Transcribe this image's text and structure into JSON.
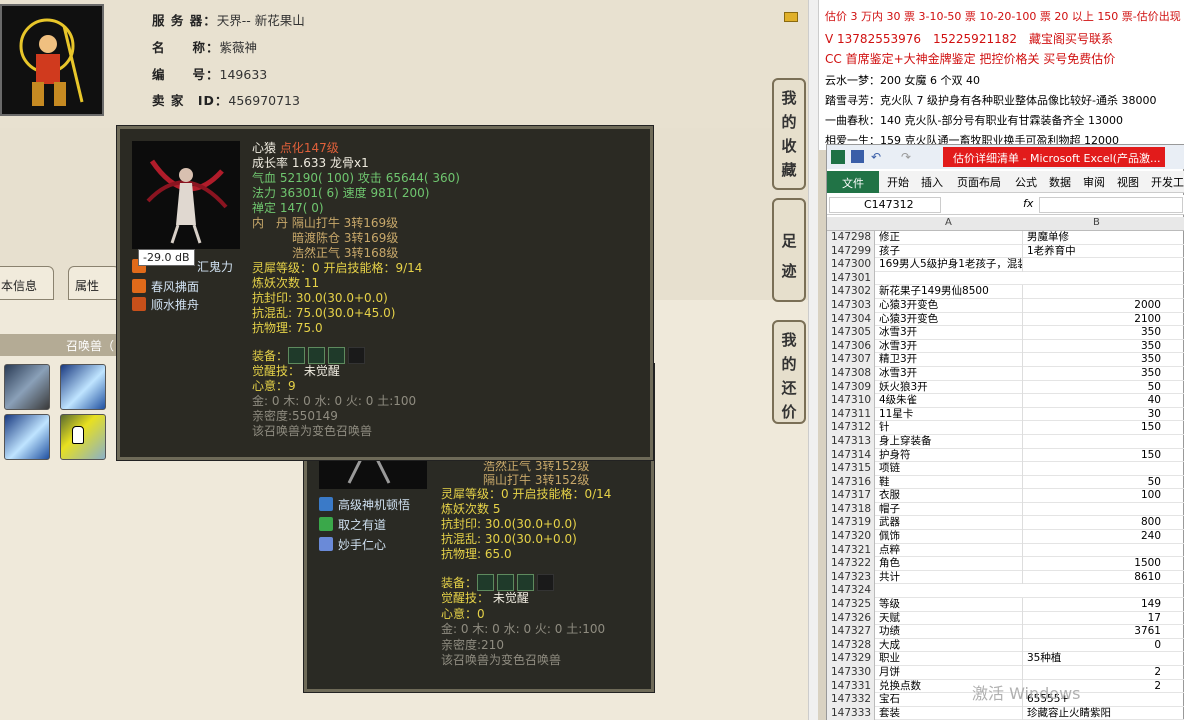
{
  "player": {
    "server_label": "服 务 器：",
    "server_value": "天界-- 新花果山",
    "name_label": "名　　称：",
    "name_value": "紫薇神",
    "id_label": "编　　号：",
    "id_value": "149633",
    "seller_label": "卖 家　ID：",
    "seller_value": "456970713"
  },
  "tabs": {
    "basic": "本信息",
    "attr": "属性"
  },
  "summon_bar": "召唤兽（",
  "side_buttons": [
    {
      "label": "我的收藏"
    },
    {
      "label": "足迹"
    },
    {
      "label": "我的还价"
    }
  ],
  "volume_tooltip": "-29.0 dB",
  "tip_front": {
    "name": "心猿",
    "name_suffix": "点化147级",
    "growth": "成长率 1.633 龙骨x1",
    "hp_label": "气血 ",
    "hp": "52190( 100)",
    "atk_label": " 攻击 ",
    "atk": "65644( 360)",
    "mp_label": "法力 ",
    "mp": "36301( 6)",
    "spd_label": " 速度 ",
    "spd": "981( 200)",
    "zen": "禅定 147( 0)",
    "dan1": "内　丹 隔山打牛 3转169级",
    "dan2": "暗渡陈仓 3转169级",
    "dan3": "浩然正气 3转168级",
    "spirit": "灵犀等级：0 开启技能格：9/14",
    "refine": "炼妖次数 11",
    "res1": "抗封印: 30.0(30.0+0.0)",
    "res2": "抗混乱: 75.0(30.0+45.0)",
    "res3": "抗物理: 75.0",
    "equip_label": "装备：",
    "awaken_label": "觉醒技：",
    "awaken_value": "未觉醒",
    "heart_label": "心意：",
    "heart_value": "9",
    "elements": "金: 0 木: 0 水: 0 火: 0 土:100",
    "intimacy": "亲密度:550149",
    "variant": "该召唤兽为变色召唤兽",
    "skills": [
      "汇鬼力",
      "春风拂面",
      "顺水推舟"
    ]
  },
  "tip_back": {
    "dan_partial1": "浩然正气 3转152级",
    "dan_partial2": "隔山打牛 3转152级",
    "spirit": "灵犀等级：0 开启技能格：0/14",
    "refine": "炼妖次数 5",
    "res1": "抗封印: 30.0(30.0+0.0)",
    "res2": "抗混乱: 30.0(30.0+0.0)",
    "res3": "抗物理: 65.0",
    "equip_label": "装备：",
    "awaken_label": "觉醒技：",
    "awaken_value": "未觉醒",
    "heart_label": "心意：",
    "heart_value": "0",
    "elements": "金: 0 木: 0 水: 0 火: 0 土:100",
    "intimacy": "亲密度:210",
    "variant": "该召唤兽为变色召唤兽",
    "skills": [
      "高级神机顿悟",
      "取之有道",
      "妙手仁心"
    ]
  },
  "doc_lines": [
    "估价 3 万内 30 票 3-10-50 票 10-20-100 票 20 以上 150 票-估价出现",
    "V 13782553976　15225921182　藏宝阁买号联系",
    "CC 首席鉴定+大神金牌鉴定 把控价格关 买号免费估价",
    "云水一梦：200 女魔 6 个双 40",
    "踏雪寻芳：克火队 7 级护身有各种职业整体品像比较好-通杀 38000",
    "一曲春秋：140 克火队-部分号有职业有甘霖装备齐全 13000",
    "相爱一生：159 克火队通一畜牧职业换手可盈利物超 12000"
  ],
  "excel": {
    "title": "估价详细清单 - Microsoft Excel(产品激...",
    "file_tab": "文件",
    "ribbon": [
      "开始",
      "插入",
      "页面布局",
      "公式",
      "数据",
      "审阅",
      "视图",
      "开发工"
    ],
    "name_box": "C147312",
    "fx": "fx",
    "col_a": "A",
    "col_b": "B",
    "rows": [
      {
        "n": "147298",
        "a": "修正",
        "b": "男魔单修",
        "num": false
      },
      {
        "n": "147299",
        "a": "孩子",
        "b": "1老养育中",
        "num": false
      },
      {
        "n": "147300",
        "a": "169男人5级护身1老孩子，混装备一套",
        "b": "",
        "num": false
      },
      {
        "n": "147301",
        "a": "",
        "b": "",
        "num": false
      },
      {
        "n": "147302",
        "a": "新花果子149男仙8500",
        "b": "",
        "num": false
      },
      {
        "n": "147303",
        "a": "心猿3开变色",
        "b": "2000",
        "num": true
      },
      {
        "n": "147304",
        "a": "心猿3开变色",
        "b": "2100",
        "num": true
      },
      {
        "n": "147305",
        "a": "冰雪3开",
        "b": "350",
        "num": true
      },
      {
        "n": "147306",
        "a": "冰雪3开",
        "b": "350",
        "num": true
      },
      {
        "n": "147307",
        "a": "精卫3开",
        "b": "350",
        "num": true
      },
      {
        "n": "147308",
        "a": "冰雪3开",
        "b": "350",
        "num": true
      },
      {
        "n": "147309",
        "a": "妖火狼3开",
        "b": "50",
        "num": true
      },
      {
        "n": "147310",
        "a": "4级朱雀",
        "b": "40",
        "num": true
      },
      {
        "n": "147311",
        "a": "11星卡",
        "b": "30",
        "num": true
      },
      {
        "n": "147312",
        "a": "针",
        "b": "150",
        "num": true
      },
      {
        "n": "147313",
        "a": "身上穿装备",
        "b": "",
        "num": false
      },
      {
        "n": "147314",
        "a": "护身符",
        "b": "150",
        "num": true
      },
      {
        "n": "147315",
        "a": "项链",
        "b": "",
        "num": false
      },
      {
        "n": "147316",
        "a": "鞋",
        "b": "50",
        "num": true
      },
      {
        "n": "147317",
        "a": "衣服",
        "b": "100",
        "num": true
      },
      {
        "n": "147318",
        "a": "帽子",
        "b": "",
        "num": false
      },
      {
        "n": "147319",
        "a": "武器",
        "b": "800",
        "num": true
      },
      {
        "n": "147320",
        "a": "佩饰",
        "b": "240",
        "num": true
      },
      {
        "n": "147321",
        "a": "点粹",
        "b": "",
        "num": false
      },
      {
        "n": "147322",
        "a": "角色",
        "b": "1500",
        "num": true
      },
      {
        "n": "147323",
        "a": "共计",
        "b": "8610",
        "num": true
      },
      {
        "n": "147324",
        "a": "",
        "b": "",
        "num": false
      },
      {
        "n": "147325",
        "a": "等级",
        "b": "149",
        "num": true
      },
      {
        "n": "147326",
        "a": "天赋",
        "b": "17",
        "num": true
      },
      {
        "n": "147327",
        "a": "功绩",
        "b": "3761",
        "num": true
      },
      {
        "n": "147328",
        "a": "大成",
        "b": "0",
        "num": true
      },
      {
        "n": "147329",
        "a": "职业",
        "b": "35种植",
        "num": false
      },
      {
        "n": "147330",
        "a": "月饼",
        "b": "2",
        "num": true
      },
      {
        "n": "147331",
        "a": "兑换点数",
        "b": "2",
        "num": true
      },
      {
        "n": "147332",
        "a": "宝石",
        "b": "65555+",
        "num": false
      },
      {
        "n": "147333",
        "a": "套装",
        "b": "珍藏容止火睛紫阳",
        "num": false
      }
    ]
  },
  "watermark": "激活 Windows"
}
